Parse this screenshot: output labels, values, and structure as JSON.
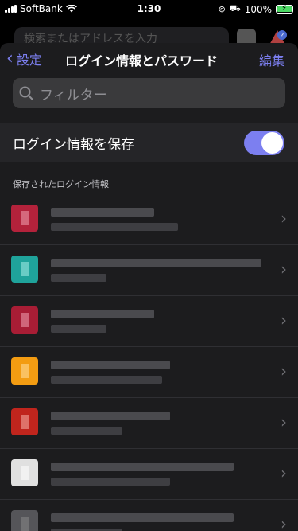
{
  "status_bar": {
    "carrier": "SoftBank",
    "time": "1:30",
    "battery": "100%"
  },
  "browser_behind": {
    "url_placeholder": "検索またはアドレスを入力"
  },
  "navbar": {
    "back_label": "設定",
    "title": "ログイン情報とパスワード",
    "edit_label": "編集"
  },
  "filter": {
    "placeholder": "フィルター"
  },
  "save_logins": {
    "label": "ログイン情報を保存",
    "enabled": true
  },
  "section_header": "保存されたログイン情報",
  "logins": [
    {
      "favicon_color": "#b3223b",
      "favicon_inner": "#f0a3b3"
    },
    {
      "favicon_color": "#1fa39b",
      "favicon_inner": "#a8efe8"
    },
    {
      "favicon_color": "#a81d35",
      "favicon_inner": "#f0a3b3"
    },
    {
      "favicon_color": "#f39c12",
      "favicon_inner": "#ffe0a3"
    },
    {
      "favicon_color": "#c0251d",
      "favicon_inner": "#f5b3a8"
    },
    {
      "favicon_color": "#e0e0e0",
      "favicon_inner": "#ffffff"
    },
    {
      "favicon_color": "#555559",
      "favicon_inner": "#888888"
    }
  ],
  "colors": {
    "accent": "#7c7ff0",
    "sheet_bg": "#1c1c1e"
  }
}
